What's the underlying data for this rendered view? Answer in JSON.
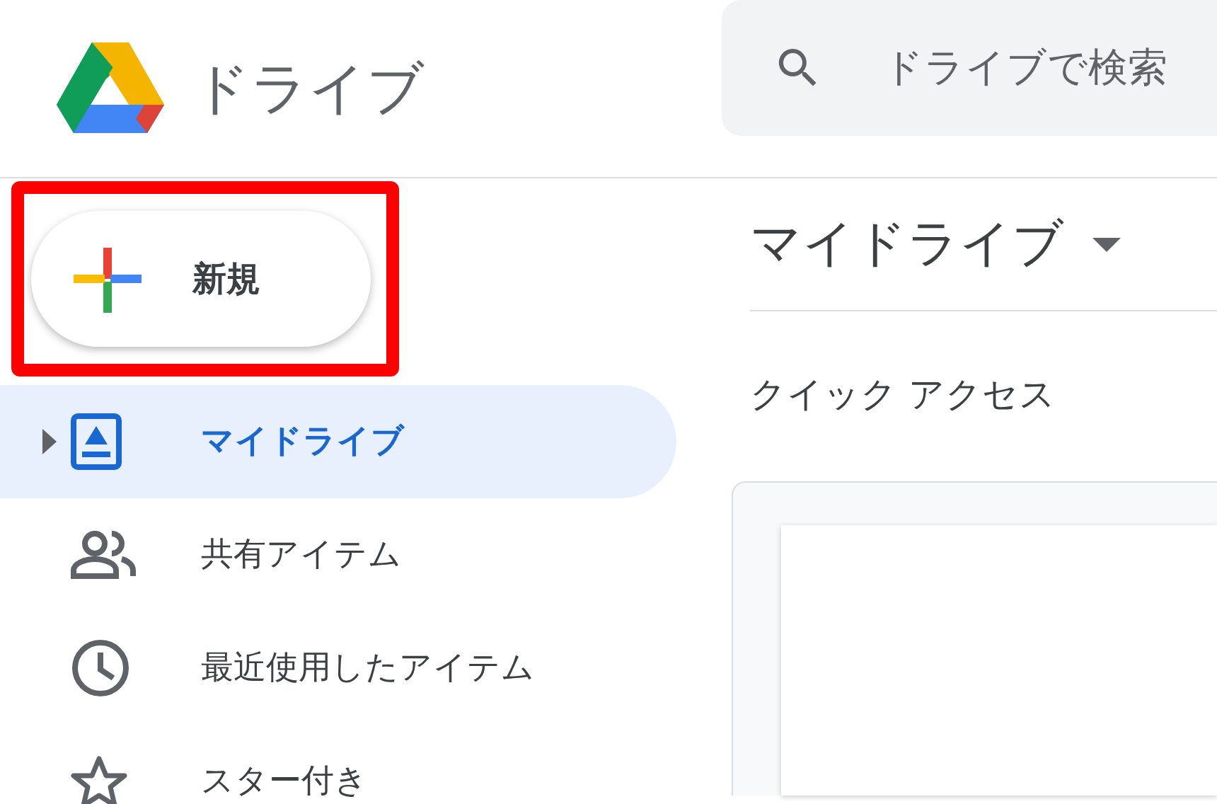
{
  "app": {
    "title": "ドライブ"
  },
  "search": {
    "placeholder": "ドライブで検索"
  },
  "new_button": {
    "label": "新規",
    "highlighted": true
  },
  "sidebar": {
    "items": [
      {
        "label": "マイドライブ",
        "kind": "drive",
        "selected": true,
        "expandable": true
      },
      {
        "label": "共有アイテム",
        "kind": "people",
        "selected": false,
        "expandable": false
      },
      {
        "label": "最近使用したアイテム",
        "kind": "clock",
        "selected": false,
        "expandable": false
      },
      {
        "label": "スター付き",
        "kind": "star",
        "selected": false,
        "expandable": false
      }
    ]
  },
  "main": {
    "title": "マイドライブ",
    "section": "クイック アクセス"
  }
}
